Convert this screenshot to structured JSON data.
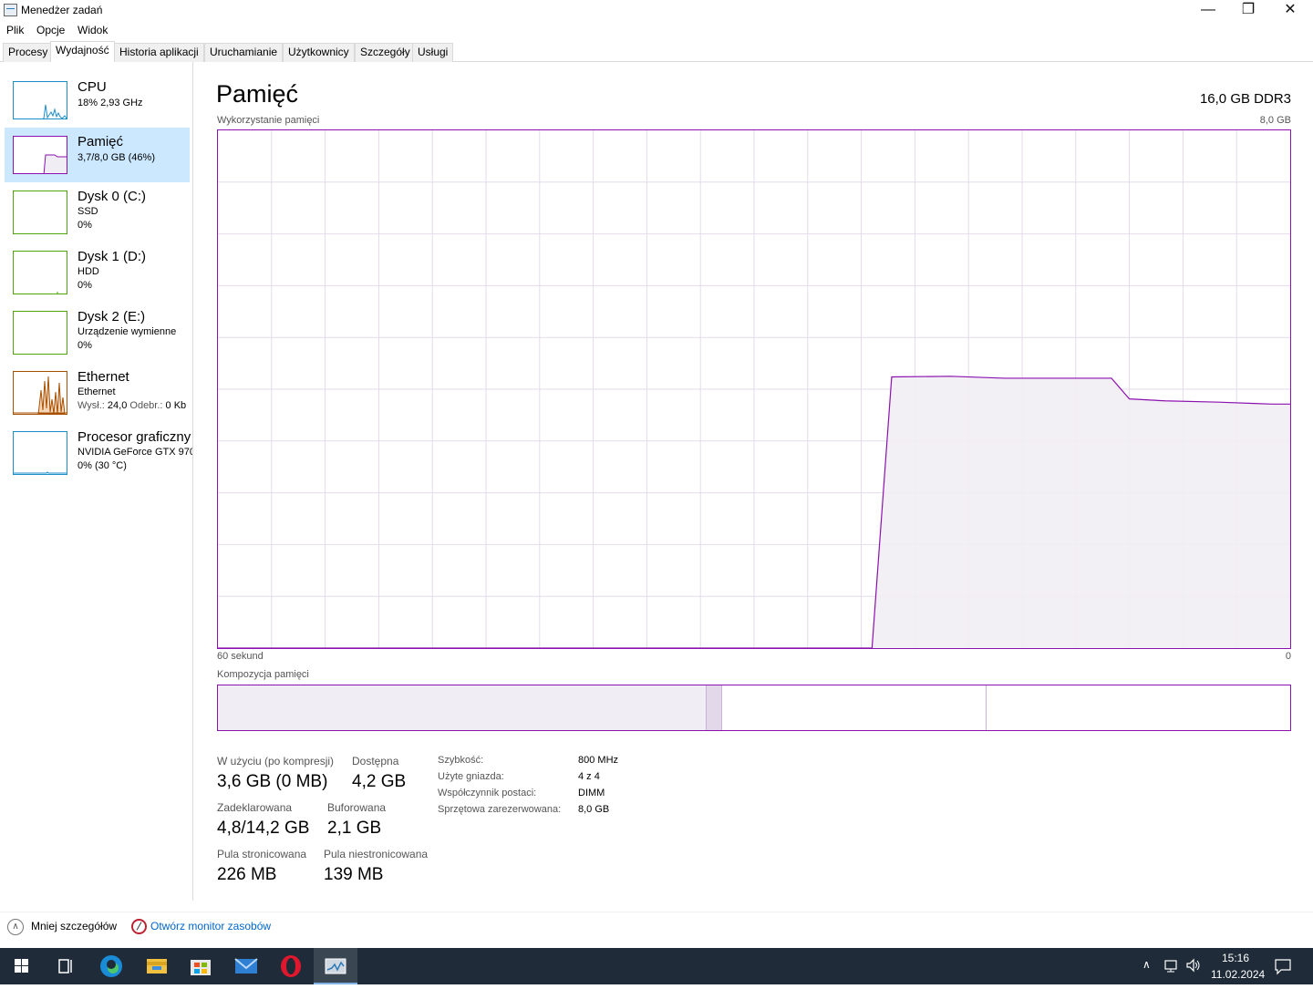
{
  "window": {
    "title": "Menedżer zadań",
    "minimize": "—",
    "maximize": "❐",
    "close": "✕"
  },
  "menu": [
    "Plik",
    "Opcje",
    "Widok"
  ],
  "tabs": [
    "Procesy",
    "Wydajność",
    "Historia aplikacji",
    "Uruchamianie",
    "Użytkownicy",
    "Szczegóły",
    "Usługi"
  ],
  "active_tab": "Wydajność",
  "sidebar": {
    "items": [
      {
        "title": "CPU",
        "line1": "18% 2,93 GHz",
        "color": "#1c8fcb"
      },
      {
        "title": "Pamięć",
        "line1": "3,7/8,0 GB (46%)",
        "color": "#8b12ae",
        "selected": true
      },
      {
        "title": "Dysk 0 (C:)",
        "line1": "SSD",
        "line2": "0%",
        "color": "#4da60c"
      },
      {
        "title": "Dysk 1 (D:)",
        "line1": "HDD",
        "line2": "0%",
        "color": "#4da60c"
      },
      {
        "title": "Dysk 2 (E:)",
        "line1": "Urządzenie wymienne",
        "line2": "0%",
        "color": "#4da60c"
      },
      {
        "title": "Ethernet",
        "line1": "Ethernet",
        "line2_send_label": "Wysł.:",
        "line2_send": "24,0",
        "line2_recv_label": "Odebr.:",
        "line2_recv": "0 Kb",
        "color": "#a74f01"
      },
      {
        "title": "Procesor graficzny",
        "line1": "NVIDIA GeForce GTX 970",
        "line2": "0% (30 °C)",
        "color": "#1c8fcb"
      }
    ]
  },
  "panel": {
    "title": "Pamięć",
    "capacity": "16,0 GB DDR3",
    "usage_label": "Wykorzystanie pamięci",
    "usage_max": "8,0 GB",
    "time_left": "60 sekund",
    "time_right": "0",
    "composition_label": "Kompozycja pamięci"
  },
  "chart_data": {
    "type": "area",
    "title": "Wykorzystanie pamięci",
    "xlabel": "",
    "ylabel": "",
    "x_range_seconds": [
      60,
      0
    ],
    "ylim": [
      0,
      8.0
    ],
    "unit": "GB",
    "color": "#8b12ae",
    "x": [
      60,
      23.4,
      22.3,
      19,
      16,
      13,
      10,
      9,
      7,
      4,
      2,
      1,
      0
    ],
    "values": [
      0,
      0,
      4.19,
      4.2,
      4.17,
      4.17,
      4.17,
      3.85,
      3.82,
      3.8,
      3.78,
      3.77,
      3.77
    ]
  },
  "composition": {
    "used_fraction": 0.455,
    "modified_fraction": 0.014,
    "standby_fraction": 0.247,
    "free_fraction": 0.284
  },
  "stats": {
    "in_use_label": "W użyciu (po kompresji)",
    "in_use_value": "3,6 GB (0 MB)",
    "available_label": "Dostępna",
    "available_value": "4,2 GB",
    "committed_label": "Zadeklarowana",
    "committed_value": "4,8/14,2 GB",
    "cached_label": "Buforowana",
    "cached_value": "2,1 GB",
    "paged_label": "Pula stronicowana",
    "paged_value": "226 MB",
    "nonpaged_label": "Pula niestronicowana",
    "nonpaged_value": "139 MB"
  },
  "properties": [
    {
      "label": "Szybkość:",
      "value": "800 MHz"
    },
    {
      "label": "Użyte gniazda:",
      "value": "4 z 4"
    },
    {
      "label": "Współczynnik postaci:",
      "value": "DIMM"
    },
    {
      "label": "Sprzętowa zarezerwowana:",
      "value": "8,0 GB"
    }
  ],
  "footer": {
    "fewer_details": "Mniej szczegółów",
    "open_monitor": "Otwórz monitor zasobów"
  },
  "taskbar": {
    "icons": [
      "windows-start-icon",
      "task-view-icon",
      "edge-icon",
      "file-explorer-icon",
      "store-icon",
      "mail-icon",
      "opera-icon",
      "task-manager-icon"
    ],
    "time": "15:16",
    "date": "11.02.2024"
  }
}
